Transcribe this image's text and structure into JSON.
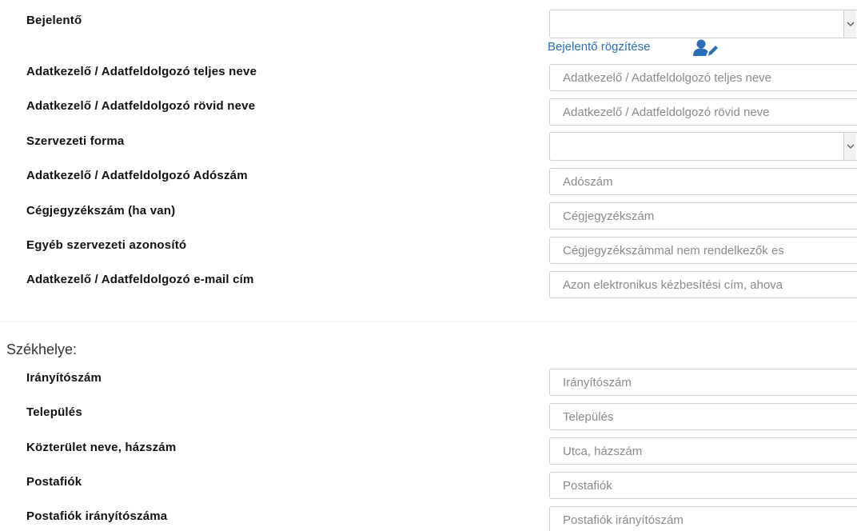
{
  "form": {
    "bejelento": {
      "label": "Bejelentő",
      "value": "",
      "link_label": "Bejelentő rögzítése"
    },
    "full_name": {
      "label": "Adatkezelő / Adatfeldolgozó teljes neve",
      "placeholder": "Adatkezelő / Adatfeldolgozó teljes neve"
    },
    "short_name": {
      "label": "Adatkezelő / Adatfeldolgozó rövid neve",
      "placeholder": "Adatkezelő / Adatfeldolgozó rövid neve"
    },
    "org_form": {
      "label": "Szervezeti forma",
      "value": ""
    },
    "tax_number": {
      "label": "Adatkezelő / Adatfeldolgozó Adószám",
      "placeholder": "Adószám"
    },
    "company_reg": {
      "label": "Cégjegyzékszám (ha van)",
      "placeholder": "Cégjegyzékszám"
    },
    "other_id": {
      "label": "Egyéb szervezeti azonosító",
      "placeholder": "Cégjegyzékszámmal nem rendelkezők es"
    },
    "email": {
      "label": "Adatkezelő / Adatfeldolgozó e-mail cím",
      "placeholder": "Azon elektronikus kézbesítési cím, ahova"
    }
  },
  "seat": {
    "title": "Székhelye:",
    "zip": {
      "label": "Irányítószám",
      "placeholder": "Irányítószám"
    },
    "city": {
      "label": "Település",
      "placeholder": "Település"
    },
    "street": {
      "label": "Közterület neve, házszám",
      "placeholder": "Utca, házszám"
    },
    "po_box": {
      "label": "Postafiók",
      "placeholder": "Postafiók"
    },
    "po_box_zip": {
      "label": "Postafiók irányítószáma",
      "placeholder": "Postafiók irányítószám"
    }
  },
  "icons": {
    "bejelento_link_icon": "user-edit-icon",
    "select_arrow": "chevron-down-icon"
  },
  "colors": {
    "link": "#2a6ebb",
    "border": "#cfcfcf",
    "placeholder": "#8a8a8a"
  }
}
